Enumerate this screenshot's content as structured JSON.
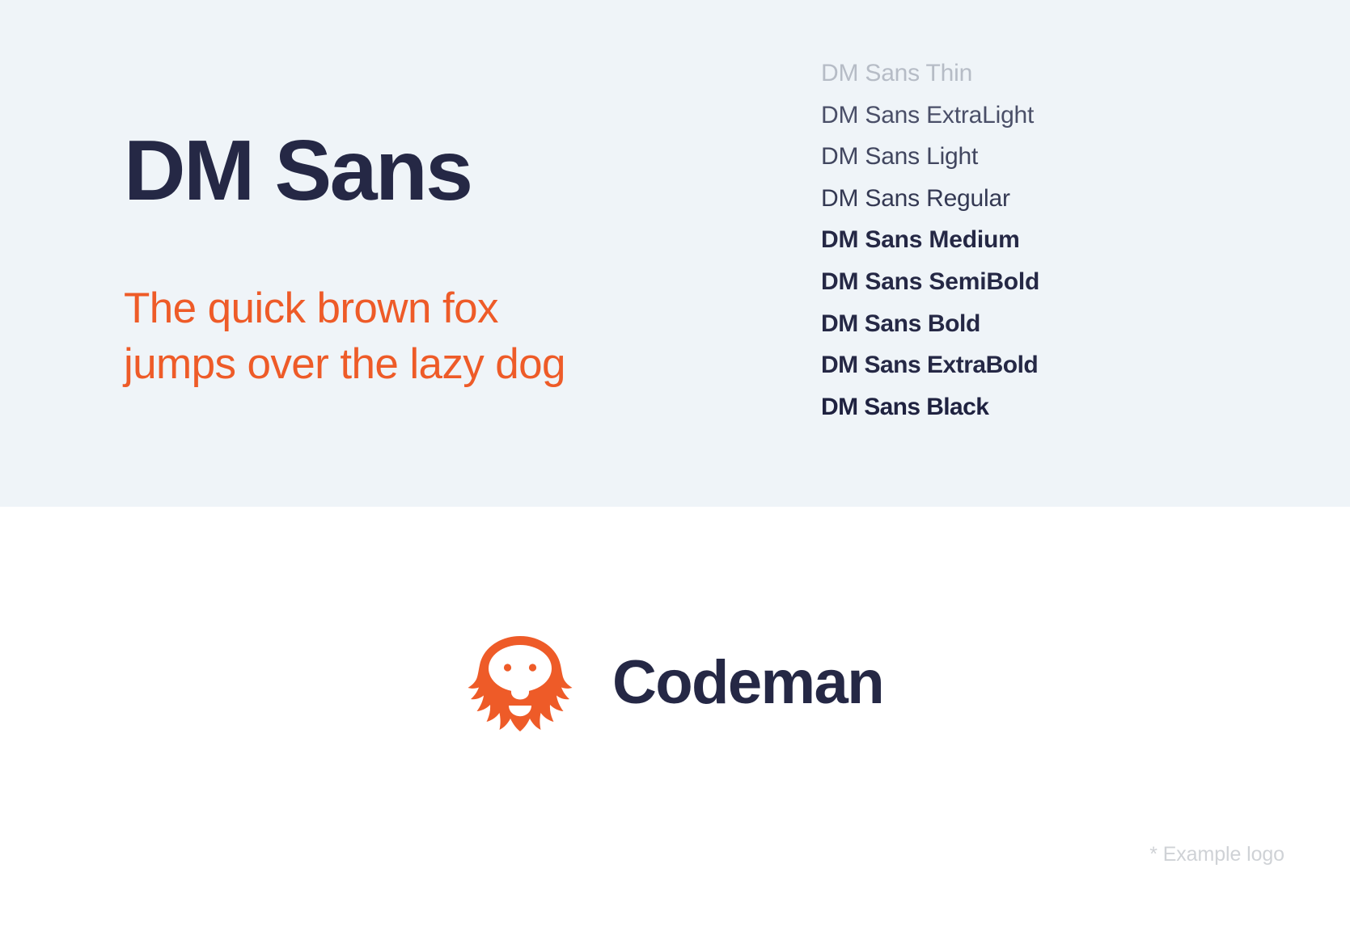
{
  "colors": {
    "panel_background": "#EFF4F8",
    "page_background": "#FFFFFF",
    "ink_navy": "#252845",
    "accent_orange": "#EE5B28",
    "muted_gray": "#CFD2D6"
  },
  "specimen": {
    "font_title": "DM Sans",
    "pangram": {
      "full": "The quick brown fox jumps over the lazy dog",
      "line1": "The quick brown fox",
      "line2": "jumps over the lazy dog"
    }
  },
  "weights": [
    {
      "label": "DM Sans Thin",
      "style": "w-thin"
    },
    {
      "label": "DM Sans ExtraLight",
      "style": "w-extralight"
    },
    {
      "label": "DM Sans Light",
      "style": "w-light"
    },
    {
      "label": "DM Sans Regular",
      "style": "w-regular"
    },
    {
      "label": "DM Sans Medium",
      "style": "w-medium"
    },
    {
      "label": "DM Sans SemiBold",
      "style": "w-semibold"
    },
    {
      "label": "DM Sans Bold",
      "style": "w-bold"
    },
    {
      "label": "DM Sans ExtraBold",
      "style": "w-extrabold"
    },
    {
      "label": "DM Sans Black",
      "style": "w-black"
    }
  ],
  "logo": {
    "mark_name": "bearded-mascot-icon",
    "wordmark": "Codeman",
    "footnote": "* Example logo"
  }
}
